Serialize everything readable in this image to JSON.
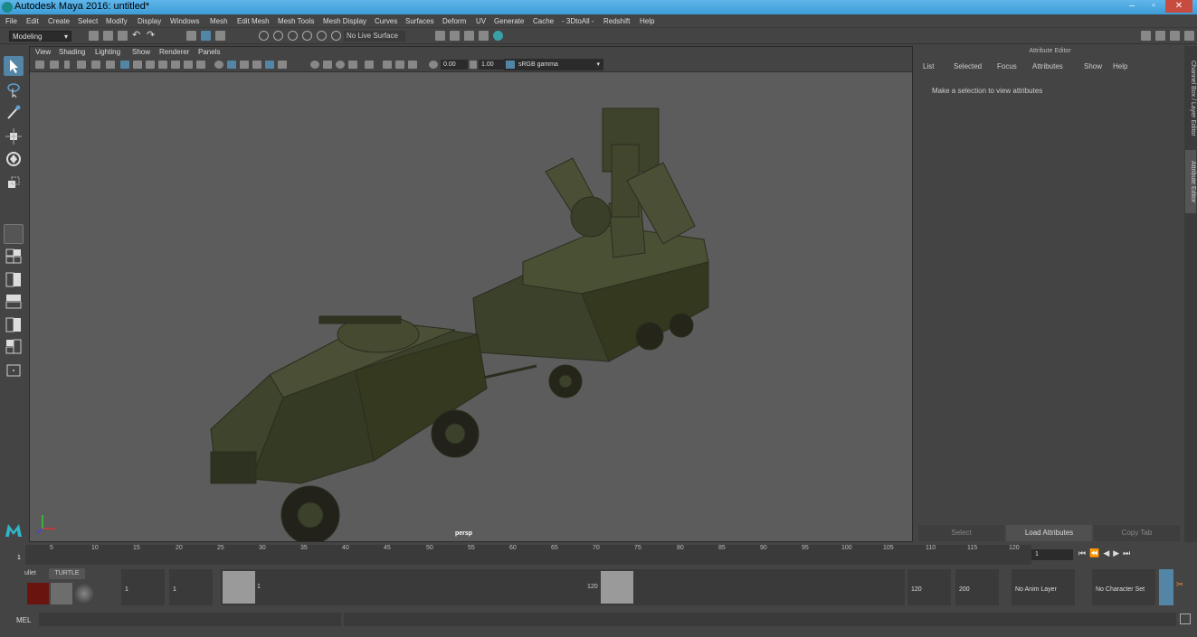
{
  "window": {
    "title": "Autodesk Maya 2016: untitled*",
    "min": "–",
    "max": "▫",
    "close": "✕"
  },
  "menubar": [
    "File",
    "Edit",
    "Create",
    "Select",
    "Modify",
    "Display",
    "Windows",
    "Mesh",
    "Edit Mesh",
    "Mesh Tools",
    "Mesh Display",
    "Curves",
    "Surfaces",
    "Deform",
    "UV",
    "Generate",
    "Cache",
    "- 3DtoAll -",
    "Redshift",
    "Help"
  ],
  "toolbar": {
    "mode": "Modeling",
    "live_surface": "No Live Surface"
  },
  "viewport": {
    "menu": [
      "View",
      "Shading",
      "Lighting",
      "Show",
      "Renderer",
      "Panels"
    ],
    "exposure": "0.00",
    "gamma": "1.00",
    "color_space": "sRGB gamma",
    "camera": "persp"
  },
  "attribute_editor": {
    "title": "Attribute Editor",
    "menu": [
      "List",
      "Selected",
      "Focus",
      "Attributes",
      "Show",
      "Help"
    ],
    "message": "Make a selection to view attributes",
    "buttons": {
      "select": "Select",
      "load": "Load Attributes",
      "copy": "Copy Tab"
    }
  },
  "side_tabs": {
    "channel_box": "Channel Box / Layer Editor",
    "attribute_editor": "Attribute Editor"
  },
  "timeline": {
    "ticks": [
      "5",
      "10",
      "15",
      "20",
      "25",
      "30",
      "35",
      "40",
      "45",
      "50",
      "55",
      "60",
      "65",
      "70",
      "75",
      "80",
      "85",
      "90",
      "95",
      "100",
      "105",
      "110",
      "115",
      "120"
    ],
    "start_marker": "1",
    "current_frame": "1"
  },
  "range": {
    "shelf_tab_1": "ullet",
    "shelf_tab_2": "TURTLE",
    "start": "1",
    "playback_start": "1",
    "slider_start": "1",
    "slider_end": "120",
    "playback_end": "120",
    "end": "200",
    "anim_layer": "No Anim Layer",
    "char_set": "No Character Set"
  },
  "cmdline": {
    "label": "MEL"
  },
  "colors": {
    "accent": "#5285a6",
    "vehicle": "#3c412c",
    "titlebar": "#4aa8e0"
  }
}
